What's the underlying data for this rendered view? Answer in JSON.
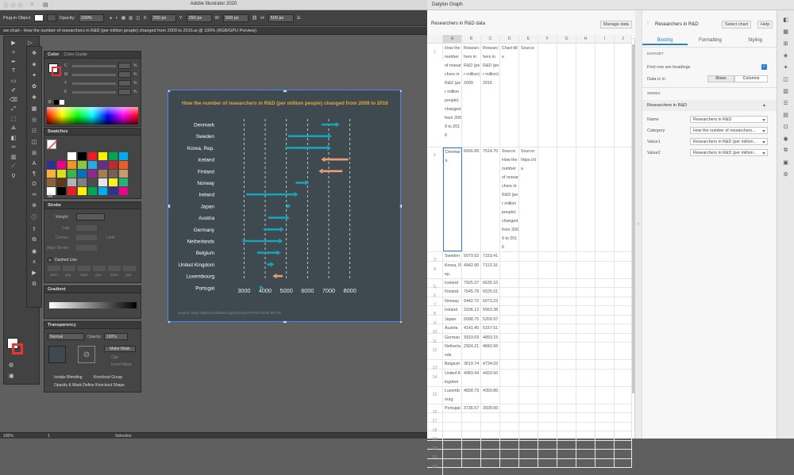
{
  "app": {
    "title": "Adobe Illustrator 2020",
    "doc_tab": "ow chart - How the number of researchers in R&D (per million people) changed from 2009 to 2016.ai @ 100% (RGB/GPU Preview)"
  },
  "control_bar": {
    "plugin_label": "Plug-in Object",
    "opacity_label": "Opacity:",
    "opacity_value": "100%",
    "x_label": "X:",
    "x_value": "250 px",
    "y_label": "Y:",
    "y_value": "250 px",
    "w_label": "W:",
    "w_value": "500 px",
    "h_label": "H:",
    "h_value": "500 px"
  },
  "color_panel": {
    "tab_color": "Color",
    "tab_guide": "Color Guide",
    "channels": [
      "C",
      "M",
      "Y",
      "K"
    ],
    "percent": "%"
  },
  "swatches_panel": {
    "title": "Swatches"
  },
  "stroke_panel": {
    "title": "Stroke",
    "weight_label": "Weight:",
    "cap_label": "Cap:",
    "corner_label": "Corner:",
    "limit_label": "Limit:",
    "align_label": "Align Stroke:",
    "dashed_label": "Dashed Line",
    "dash_fields": [
      "dash",
      "gap",
      "dash",
      "gap",
      "dash",
      "gap"
    ]
  },
  "gradient_panel": {
    "title": "Gradient"
  },
  "transparency_panel": {
    "title": "Transparency",
    "mode": "Normal",
    "opacity_label": "Opacity:",
    "opacity_value": "100%",
    "make_mask": "Make Mask",
    "clip": "Clip",
    "invert_mask": "Invert Mask",
    "isolate_blending": "Isolate Blending",
    "knockout_group": "Knockout Group",
    "opacity_mask_define": "Opacity & Mask Define Knockout Shape"
  },
  "status_bar": {
    "zoom": "100%",
    "artboard": "1",
    "mode": "Selection"
  },
  "chart_data": {
    "type": "arrow",
    "title": "How the number of researchers in R&D (per million people) changed from 2009 to 2016",
    "source": "Source: https://data.worldbank.org/indicator/SP.POP.SCIE.RD.P6",
    "xlim": [
      2800,
      8800
    ],
    "xticks": [
      3000,
      4000,
      5000,
      6000,
      7000,
      8000
    ],
    "categories": [
      "Denmark",
      "Sweden",
      "Korea, Rep.",
      "Iceland",
      "Finland",
      "Norway",
      "Ireland",
      "Japan",
      "Austria",
      "Germany",
      "Netherlands",
      "Belgium",
      "United Kingdom",
      "Luxembourg",
      "Portugal"
    ],
    "series": [
      {
        "name": "2009",
        "values": [
          6656.9,
          5079.5,
          4942.9,
          7925.4,
          7645.8,
          5442.7,
          3106.1,
          5098.8,
          4141.4,
          3919.0,
          2924.2,
          3619.7,
          4083.4,
          4828.7,
          3736.6
        ]
      },
      {
        "name": "2016",
        "values": [
          7514.7,
          7153.4,
          7113.2,
          6635.1,
          6525.0,
          6073.2,
          5563.4,
          5209.9,
          5157.5,
          4893.2,
          4842.6,
          4734.0,
          4429.5,
          4350.9,
          3928.6
        ]
      }
    ],
    "colors": {
      "increase": "#1aa3b8",
      "decrease": "#ec9f76"
    }
  },
  "datylon": {
    "window_title": "Datylon Graph",
    "data_title": "Researchers in R&D data",
    "manage_data": "Manage data",
    "columns": [
      "A",
      "B",
      "C",
      "D",
      "E",
      "F",
      "G",
      "H",
      "I",
      "J"
    ],
    "header_row": {
      "num": "1",
      "a": "How the number of researchers in R&D (per million people) changed from 2009 to 2016",
      "b": "Researchers in R&D (per million) 2009",
      "c": "Researchers in R&D (per million) 2016",
      "d": "Chart title",
      "e": "Source"
    },
    "row2": {
      "num": "2",
      "a": "Denmark",
      "b": "6656.89",
      "c": "7514.70",
      "d": "Source: How the number of researchers in R&D (per million people) changed from 2009 to 2016",
      "e": "Source: https://da"
    },
    "rows": [
      {
        "num": "3",
        "a": "Sweden",
        "b": "5079.52",
        "c": "7153.41"
      },
      {
        "num": "4",
        "a": "Korea, Rep.",
        "b": "4942.90",
        "c": "7113.16"
      },
      {
        "num": "5",
        "a": "Iceland",
        "b": "7925.37",
        "c": "6635.10"
      },
      {
        "num": "6",
        "a": "Finland",
        "b": "7645.78",
        "c": "6525.01"
      },
      {
        "num": "7",
        "a": "Norway",
        "b": "5442.72",
        "c": "6073.23"
      },
      {
        "num": "8",
        "a": "Ireland",
        "b": "3106.12",
        "c": "5563.38"
      },
      {
        "num": "9",
        "a": "Japan",
        "b": "5098.75",
        "c": "5209.97"
      },
      {
        "num": "10",
        "a": "Austria",
        "b": "4141.40",
        "c": "5157.51"
      },
      {
        "num": "11",
        "a": "Germany",
        "b": "3919.03",
        "c": "4893.15"
      },
      {
        "num": "12",
        "a": "Netherlands",
        "b": "2924.21",
        "c": "4842.66"
      },
      {
        "num": "13",
        "a": "Belgium",
        "b": "3619.74",
        "c": "4734.03"
      },
      {
        "num": "14",
        "a": "United Kingdom",
        "b": "4083.44",
        "c": "4429.50"
      },
      {
        "num": "15",
        "a": "Luxembourg",
        "b": "4828.73",
        "c": "4350.86"
      },
      {
        "num": "16",
        "a": "Portugal",
        "b": "3736.57",
        "c": "3928.60"
      },
      {
        "num": "17",
        "a": "",
        "b": "",
        "c": ""
      },
      {
        "num": "18",
        "a": "",
        "b": "",
        "c": ""
      },
      {
        "num": "19",
        "a": "",
        "b": "",
        "c": ""
      },
      {
        "num": "20",
        "a": "",
        "b": "",
        "c": ""
      },
      {
        "num": "21",
        "a": "",
        "b": "",
        "c": ""
      },
      {
        "num": "22",
        "a": "",
        "b": "",
        "c": ""
      }
    ],
    "settings": {
      "title": "Researchers in R&D",
      "select_chart": "Select chart",
      "help": "Help",
      "tabs": [
        "Binding",
        "Formatting",
        "Styling"
      ],
      "dataset_label": "DATASET",
      "first_row_headings": "First row are headings",
      "data_is_in": "Data is in",
      "rows_btn": "Rows",
      "columns_btn": "Columns",
      "series_label": "SERIES",
      "series_name": "Researchers in R&D",
      "name_label": "Name",
      "name_value": "Researchers in R&D",
      "category_label": "Category",
      "category_value": "How the number of researchers...",
      "value1_label": "Value1",
      "value1_value": "Researchers in R&D (per million...",
      "value2_label": "Value2",
      "value2_value": "Researchers in R&D (per million..."
    }
  }
}
